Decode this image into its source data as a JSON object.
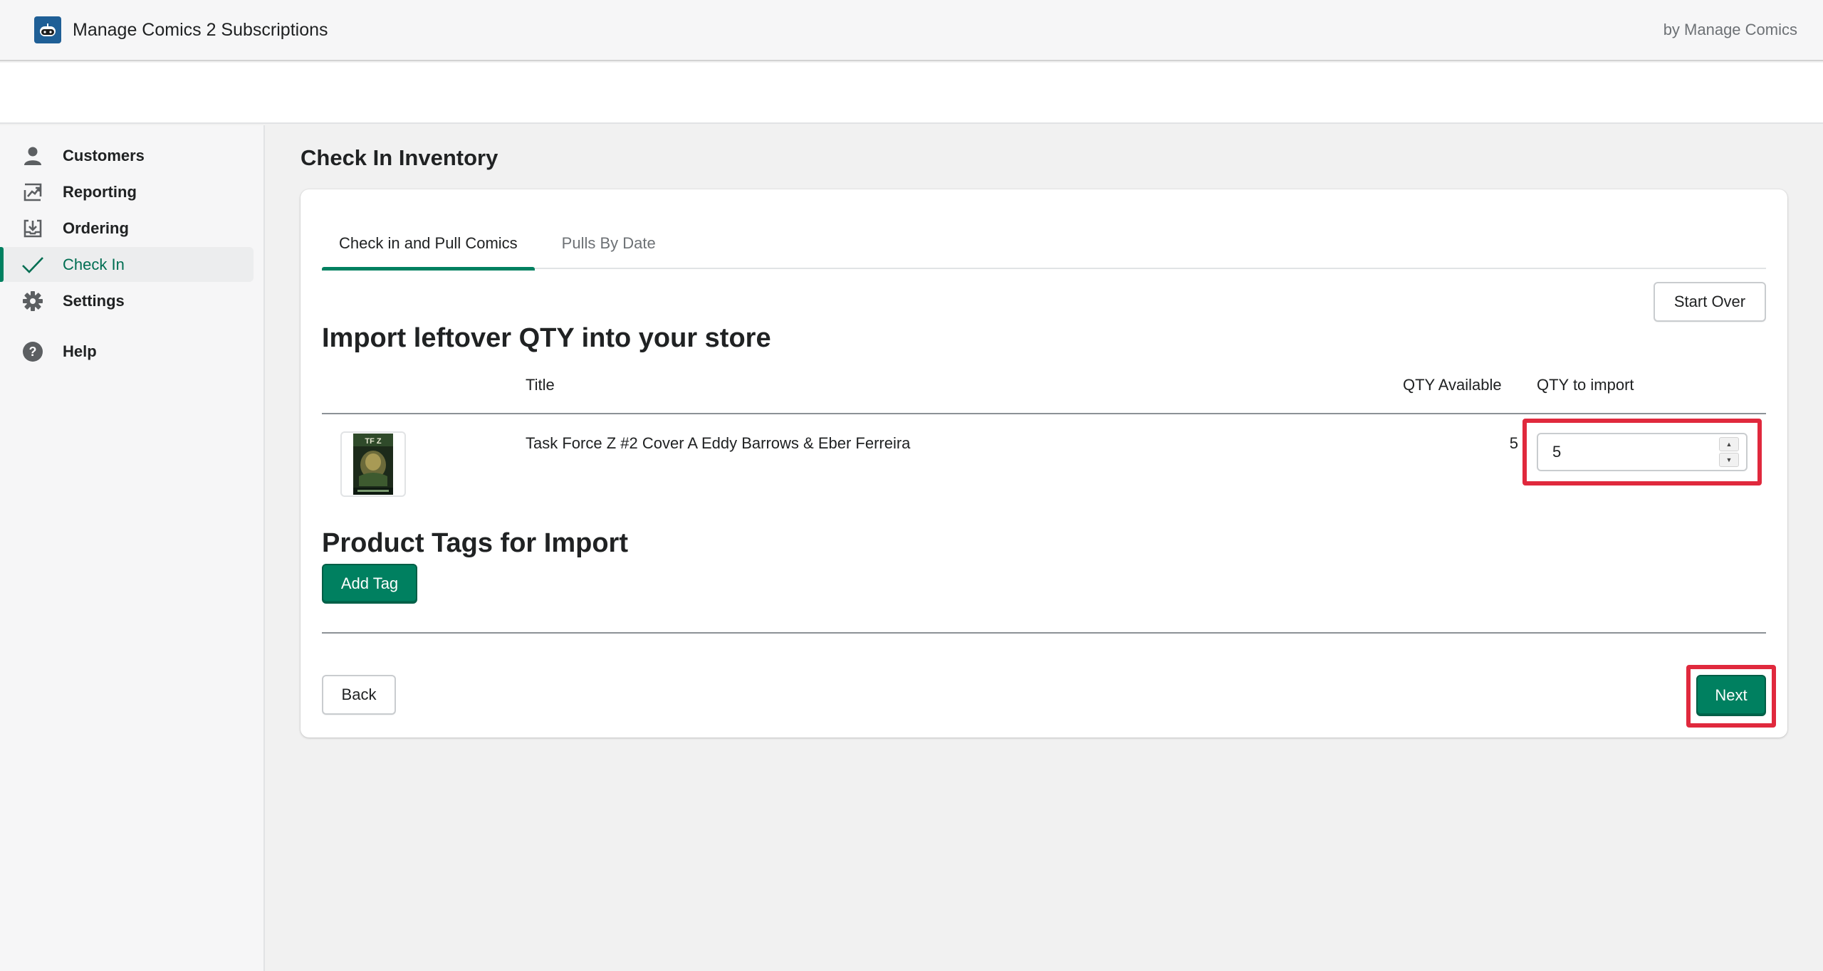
{
  "header": {
    "title": "Manage Comics 2 Subscriptions",
    "byline": "by Manage Comics",
    "logo_icon": "robot-face-icon"
  },
  "sidebar": {
    "items": [
      {
        "label": "Customers",
        "icon": "person-icon",
        "active": false
      },
      {
        "label": "Reporting",
        "icon": "chart-icon",
        "active": false
      },
      {
        "label": "Ordering",
        "icon": "download-box-icon",
        "active": false
      },
      {
        "label": "Check In",
        "icon": "checkmark-icon",
        "active": true
      },
      {
        "label": "Settings",
        "icon": "gear-icon",
        "active": false
      },
      {
        "label": "Help",
        "icon": "question-circle-icon",
        "active": false
      }
    ]
  },
  "main": {
    "page_title": "Check In Inventory",
    "tabs": [
      {
        "label": "Check in and Pull Comics",
        "active": true
      },
      {
        "label": "Pulls By Date",
        "active": false
      }
    ],
    "start_over_label": "Start Over",
    "import_heading": "Import leftover QTY into your store",
    "table": {
      "headers": {
        "title": "Title",
        "qty_available": "QTY Available",
        "qty_to_import": "QTY to import"
      },
      "rows": [
        {
          "title": "Task Force Z #2 Cover A Eddy Barrows & Eber Ferreira",
          "qty_available": "5",
          "qty_to_import": "5"
        }
      ]
    },
    "tags_heading": "Product Tags for Import",
    "add_tag_label": "Add Tag",
    "back_label": "Back",
    "next_label": "Next"
  },
  "colors": {
    "primary": "#008060",
    "highlight": "#e0293d",
    "header_bg": "#f6f6f7",
    "logo_bg": "#1f5f96"
  }
}
